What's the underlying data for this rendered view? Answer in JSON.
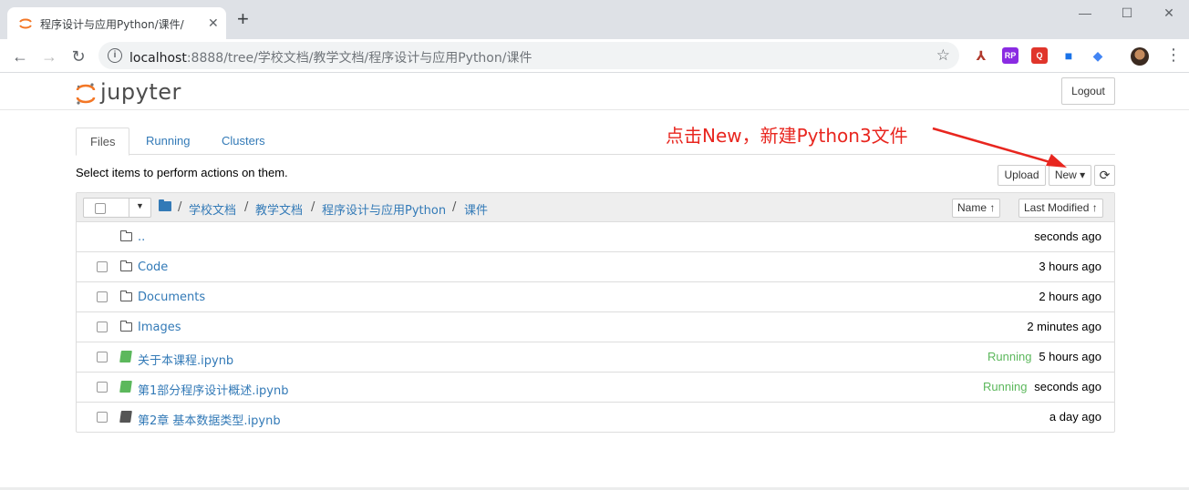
{
  "browser": {
    "tab_title": "程序设计与应用Python/课件/",
    "tab_close": "✕",
    "new_tab": "+",
    "window_controls": {
      "minimize": "—",
      "maximize": "☐",
      "close": "✕"
    },
    "nav": {
      "back": "←",
      "forward": "→",
      "reload": "↻"
    },
    "url_host": "localhost",
    "url_rest": ":8888/tree/学校文档/教学文档/程序设计与应用Python/课件",
    "info_icon": "i",
    "star": "☆",
    "extensions": [
      {
        "name": "pdf-extension-icon",
        "color": "#b0392c",
        "label": "⅄"
      },
      {
        "name": "rp-extension-icon",
        "color": "#8a2be2",
        "label": "RP"
      },
      {
        "name": "red-extension-icon",
        "color": "#e0352b",
        "label": "Q"
      },
      {
        "name": "bookmark-extension-icon",
        "color": "#1a73e8",
        "label": "■"
      },
      {
        "name": "graduation-extension-icon",
        "color": "#4285f4",
        "label": "◆"
      }
    ],
    "menu": "⋮"
  },
  "jupyter": {
    "logo_text": "jupyter",
    "logout_label": "Logout"
  },
  "tabs": [
    {
      "label": "Files",
      "active": true
    },
    {
      "label": "Running",
      "active": false
    },
    {
      "label": "Clusters",
      "active": false
    }
  ],
  "hint": "Select items to perform actions on them.",
  "toolbar": {
    "upload_label": "Upload",
    "new_label": "New ▾",
    "refresh_icon": "⟳"
  },
  "annotation": {
    "text": "点击New，新建Python3文件",
    "color": "#e8261f"
  },
  "breadcrumb": {
    "separator": "/",
    "items": [
      "学校文档",
      "教学文档",
      "程序设计与应用Python",
      "课件"
    ]
  },
  "sort": {
    "name_label": "Name ↑",
    "modified_label": "Last Modified ↑"
  },
  "files": [
    {
      "name": "..",
      "type": "parent",
      "running": "",
      "modified": "seconds ago"
    },
    {
      "name": "Code",
      "type": "folder",
      "running": "",
      "modified": "3 hours ago"
    },
    {
      "name": "Documents",
      "type": "folder",
      "running": "",
      "modified": "2 hours ago"
    },
    {
      "name": "Images",
      "type": "folder",
      "running": "",
      "modified": "2 minutes ago"
    },
    {
      "name": "关于本课程.ipynb",
      "type": "notebook-running",
      "running": "Running",
      "modified": "5 hours ago"
    },
    {
      "name": "第1部分程序设计概述.ipynb",
      "type": "notebook-running",
      "running": "Running",
      "modified": "seconds ago"
    },
    {
      "name": "第2章 基本数据类型.ipynb",
      "type": "notebook",
      "running": "",
      "modified": "a day ago"
    }
  ],
  "colors": {
    "link": "#337ab7",
    "running": "#5cb85c",
    "notebook_running": "#5cb85c",
    "notebook_idle": "#555555"
  }
}
